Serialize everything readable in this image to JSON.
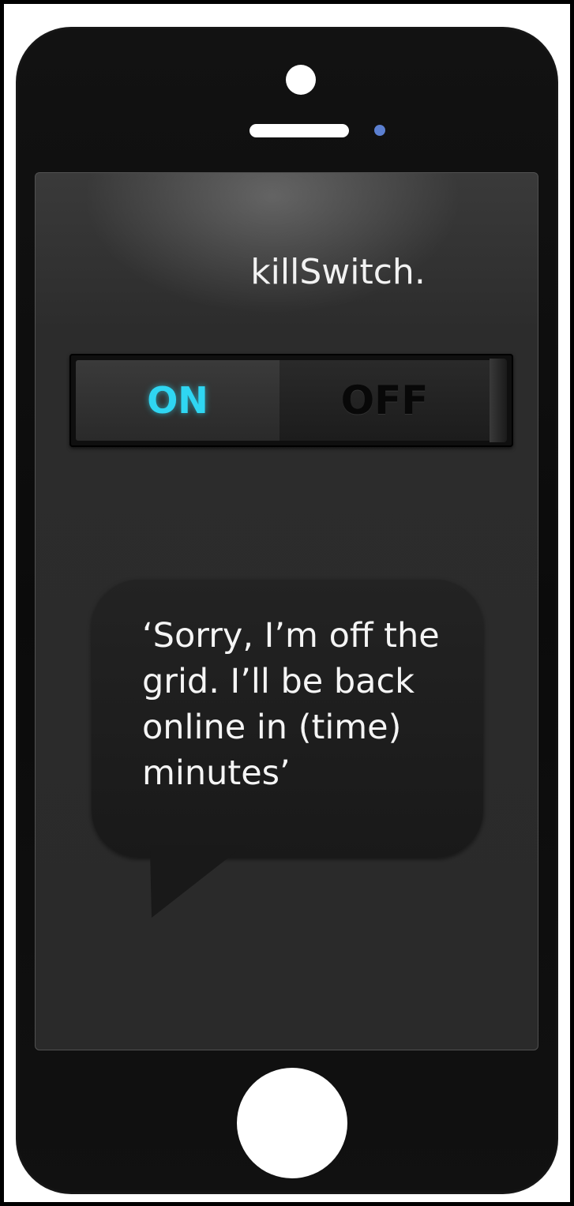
{
  "app": {
    "title": "killSwitch."
  },
  "toggle": {
    "on_label": "ON",
    "off_label": "OFF",
    "state": "on",
    "accent_color": "#2fd6f2"
  },
  "message": {
    "text": "‘Sorry, I’m off the\ngrid. I’ll be back\nonline in (time)\nminutes’"
  },
  "device": {
    "icons": [
      "camera-icon",
      "speaker-icon",
      "sensor-icon",
      "home-button"
    ]
  }
}
